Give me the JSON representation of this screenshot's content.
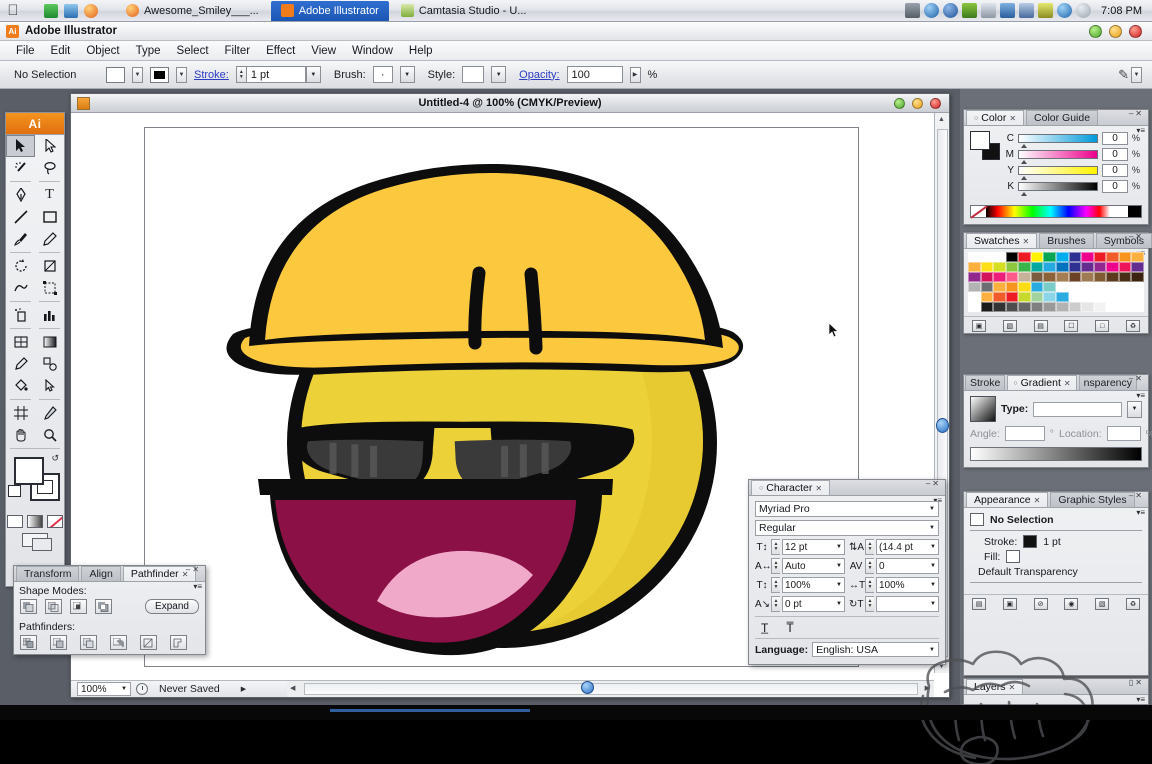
{
  "taskbar": {
    "apple_icon": "apple-logo",
    "quick_icons": [
      "mail-icon",
      "photos-icon",
      "firefox-icon"
    ],
    "tasks": [
      {
        "label": "Awesome_Smiley___...",
        "icon": "firefox-icon",
        "active": false
      },
      {
        "label": "Adobe Illustrator",
        "icon": "illustrator-icon",
        "active": true
      },
      {
        "label": "Camtasia Studio - U...",
        "icon": "camtasia-icon",
        "active": false
      }
    ],
    "tray_icons": [
      "security-icon",
      "info-icon",
      "acrobat-icon",
      "update-icon",
      "display-icon",
      "network-icon",
      "laptop-icon",
      "battery-icon",
      "sync-icon",
      "volume-icon"
    ],
    "clock": "7:08 PM"
  },
  "app": {
    "title": "Adobe Illustrator",
    "badge": "Ai",
    "window_buttons": [
      "minimize-button",
      "maximize-button",
      "close-button"
    ]
  },
  "menubar": {
    "items": [
      "File",
      "Edit",
      "Object",
      "Type",
      "Select",
      "Filter",
      "Effect",
      "View",
      "Window",
      "Help"
    ]
  },
  "controlbar": {
    "selection_status": "No Selection",
    "stroke_label": "Stroke:",
    "stroke_value": "1 pt",
    "brush_label": "Brush:",
    "brush_value": "·",
    "style_label": "Style:",
    "opacity_label": "Opacity:",
    "opacity_value": "100",
    "opacity_unit": "%"
  },
  "document": {
    "title": "Untitled-4 @ 100% (CMYK/Preview)",
    "window_buttons": [
      "minimize-button",
      "maximize-button",
      "close-button"
    ]
  },
  "statusbar": {
    "zoom": "100%",
    "status": "Never Saved"
  },
  "toolbox": {
    "logo": "Ai",
    "tools": [
      [
        "selection-tool",
        "direct-selection-tool"
      ],
      [
        "magic-wand-tool",
        "lasso-tool"
      ],
      [
        "pen-tool",
        "type-tool"
      ],
      [
        "line-segment-tool",
        "rectangle-tool"
      ],
      [
        "paintbrush-tool",
        "pencil-tool"
      ],
      [
        "rotate-tool",
        "scale-tool"
      ],
      [
        "warp-tool",
        "free-transform-tool"
      ],
      [
        "symbol-sprayer-tool",
        "column-graph-tool"
      ],
      [
        "mesh-tool",
        "gradient-tool"
      ],
      [
        "eyedropper-tool",
        "blend-tool"
      ],
      [
        "live-paint-bucket-tool",
        "live-paint-selection-tool"
      ],
      [
        "crop-area-tool",
        "slice-tool"
      ],
      [
        "hand-tool",
        "zoom-tool"
      ]
    ],
    "fill_color": "#ffffff",
    "stroke_color": "#000000",
    "modes": [
      "color-mode",
      "gradient-mode",
      "none-mode"
    ],
    "screen_mode": "screen-mode-button"
  },
  "panels": {
    "color": {
      "tabs": [
        {
          "label": "Color",
          "active": true,
          "closable": true
        },
        {
          "label": "Color Guide",
          "active": false,
          "closable": false
        }
      ],
      "channels": [
        {
          "key": "C",
          "value": "0",
          "unit": "%",
          "color": "#0099da"
        },
        {
          "key": "M",
          "value": "0",
          "unit": "%",
          "color": "#ec008c"
        },
        {
          "key": "Y",
          "value": "0",
          "unit": "%",
          "color": "#fff200"
        },
        {
          "key": "K",
          "value": "0",
          "unit": "%",
          "color": "#000000"
        }
      ]
    },
    "swatches": {
      "tabs": [
        {
          "label": "Swatches",
          "active": true,
          "closable": true
        },
        {
          "label": "Brushes",
          "active": false,
          "closable": false
        },
        {
          "label": "Symbols",
          "active": false,
          "closable": false
        }
      ],
      "rows": [
        [
          "#ffffff",
          "#ffffff",
          "#ffffff",
          "#000000",
          "#ed1c24",
          "#fff200",
          "#00a651",
          "#00aeef",
          "#2e3192",
          "#ec008c",
          "#ed1c24",
          "#f15a29",
          "#f7941e",
          "#fbb040"
        ],
        [
          "#fbb040",
          "#ffde17",
          "#d7df23",
          "#8dc63f",
          "#39b54a",
          "#00a99d",
          "#27aae1",
          "#0071bc",
          "#2e3192",
          "#662d91",
          "#92278f",
          "#ec008c",
          "#ed145b",
          "#662d91"
        ],
        [
          "#92278f",
          "#d4145a",
          "#ed1e79",
          "#ff5a8c",
          "#c7b299",
          "#7a5c3e",
          "#8c6239",
          "#a67c52",
          "#6b4226",
          "#9e7b53",
          "#7f5a33",
          "#5c3a1e",
          "#4a2f18",
          "#3b2512"
        ],
        [
          "#b3b3b3",
          "#6d6e71",
          "#fbb040",
          "#f7941e",
          "#ffde17",
          "#29abe2",
          "#7accc8",
          "#ffffff",
          "#ffffff",
          "#ffffff",
          "#ffffff",
          "#ffffff",
          "#ffffff",
          "#ffffff"
        ],
        [
          "#ffffff",
          "#fbb040",
          "#f15a29",
          "#ed1c24",
          "#c7d92d",
          "#a3d39c",
          "#8cd4e8",
          "#29abe2",
          "#ffffff",
          "#ffffff",
          "#ffffff",
          "#ffffff",
          "#ffffff",
          "#ffffff"
        ],
        [
          "#ffffff",
          "#1a1a1a",
          "#333333",
          "#4d4d4d",
          "#666666",
          "#808080",
          "#999999",
          "#b3b3b3",
          "#cccccc",
          "#e6e6e6",
          "#f2f2f2",
          "#ffffff",
          "#ffffff",
          "#ffffff"
        ]
      ],
      "buttons": [
        "swatch-libraries-button",
        "show-swatch-kinds-button",
        "swatch-options-button",
        "new-color-group-button",
        "new-swatch-button",
        "delete-swatch-button"
      ]
    },
    "gradient": {
      "tabs": [
        {
          "label": "Stroke",
          "active": false,
          "closable": false
        },
        {
          "label": "Gradient",
          "active": true,
          "closable": true
        },
        {
          "label": "nsparency",
          "active": false,
          "closable": false
        }
      ],
      "type_label": "Type:",
      "type_value": "",
      "angle_label": "Angle:",
      "angle_value": "",
      "angle_unit": "°",
      "location_label": "Location:",
      "location_value": "",
      "location_unit": "%"
    },
    "appearance": {
      "tabs": [
        {
          "label": "Appearance",
          "active": true,
          "closable": true
        },
        {
          "label": "Graphic Styles",
          "active": false,
          "closable": false
        }
      ],
      "selection": "No Selection",
      "stroke_label": "Stroke:",
      "stroke_value": "1 pt",
      "fill_label": "Fill:",
      "transparency": "Default Transparency",
      "buttons": [
        "add-new-stroke-button",
        "add-new-fill-button",
        "clear-appearance-button",
        "duplicate-item-button",
        "new-art-has-basic-appearance-button",
        "delete-item-button"
      ]
    },
    "layers": {
      "tabs": [
        {
          "label": "Layers",
          "active": true,
          "closable": true
        }
      ]
    }
  },
  "character_panel": {
    "tabs": [
      {
        "label": "Character",
        "active": true,
        "closable": true
      }
    ],
    "font_family": "Myriad Pro",
    "font_style": "Regular",
    "font_size": "12 pt",
    "leading": "(14.4 pt",
    "kerning": "Auto",
    "tracking": "0",
    "vertical_scale": "100%",
    "horizontal_scale": "100%",
    "baseline_shift": "0 pt",
    "rotation": "",
    "buttons": [
      "all-caps-button",
      "strikethrough-button"
    ],
    "language_label": "Language:",
    "language_value": "English: USA"
  },
  "pathfinder_panel": {
    "tabs": [
      {
        "label": "Transform",
        "active": false,
        "closable": false
      },
      {
        "label": "Align",
        "active": false,
        "closable": false
      },
      {
        "label": "Pathfinder",
        "active": true,
        "closable": true
      }
    ],
    "shape_modes_label": "Shape Modes:",
    "shape_mode_buttons": [
      "unite-button",
      "minus-front-button",
      "intersect-button",
      "exclude-button"
    ],
    "expand_label": "Expand",
    "pathfinders_label": "Pathfinders:",
    "pathfinder_buttons": [
      "divide-button",
      "trim-button",
      "merge-button",
      "crop-button",
      "outline-button",
      "minus-back-button"
    ]
  },
  "artwork": {
    "name": "awesome-smiley-hardhat",
    "colors": {
      "face": "#ecd139",
      "face_shadow": "#e3c32e",
      "helmet": "#fbc83e",
      "outline": "#0d0d0d",
      "glasses": "#3a3a3a",
      "glasses_light": "#585858",
      "mouth": "#8b1045",
      "tongue": "#f1a9c9"
    }
  },
  "cursor": {
    "name": "mouse-pointer",
    "x": "758",
    "y": "210"
  }
}
